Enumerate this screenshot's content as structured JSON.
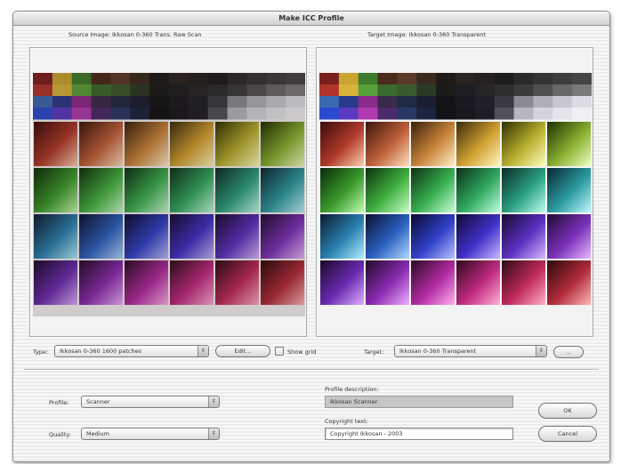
{
  "window": {
    "title": "Make ICC Profile"
  },
  "source": {
    "caption": "Source Image: Ikkosan 0-360 Trans. Raw Scan"
  },
  "target": {
    "caption": "Target Image: Ikkosan 0-360 Transparent"
  },
  "type_row": {
    "type_label": "Type:",
    "type_value": "Ikkosan 0-360 1600 patches",
    "edit_label": "Edit...",
    "show_grid_label": "Show grid",
    "show_grid_checked": false,
    "target_label": "Target:",
    "target_value": "Ikkosan 0-360 Transparent",
    "more_label": "..."
  },
  "profile": {
    "profile_label": "Profile:",
    "profile_value": "Scanner",
    "quality_label": "Quality:",
    "quality_value": "Medium",
    "description_label": "Profile description:",
    "description_value": "Ikkosan Scanner",
    "copyright_label": "Copyright text:",
    "copyright_value": "Copyright Ikkosan - 2003"
  },
  "buttons": {
    "ok": "OK",
    "cancel": "Cancel"
  },
  "icons": {
    "popup_arrows": "popup-arrows-icon"
  }
}
